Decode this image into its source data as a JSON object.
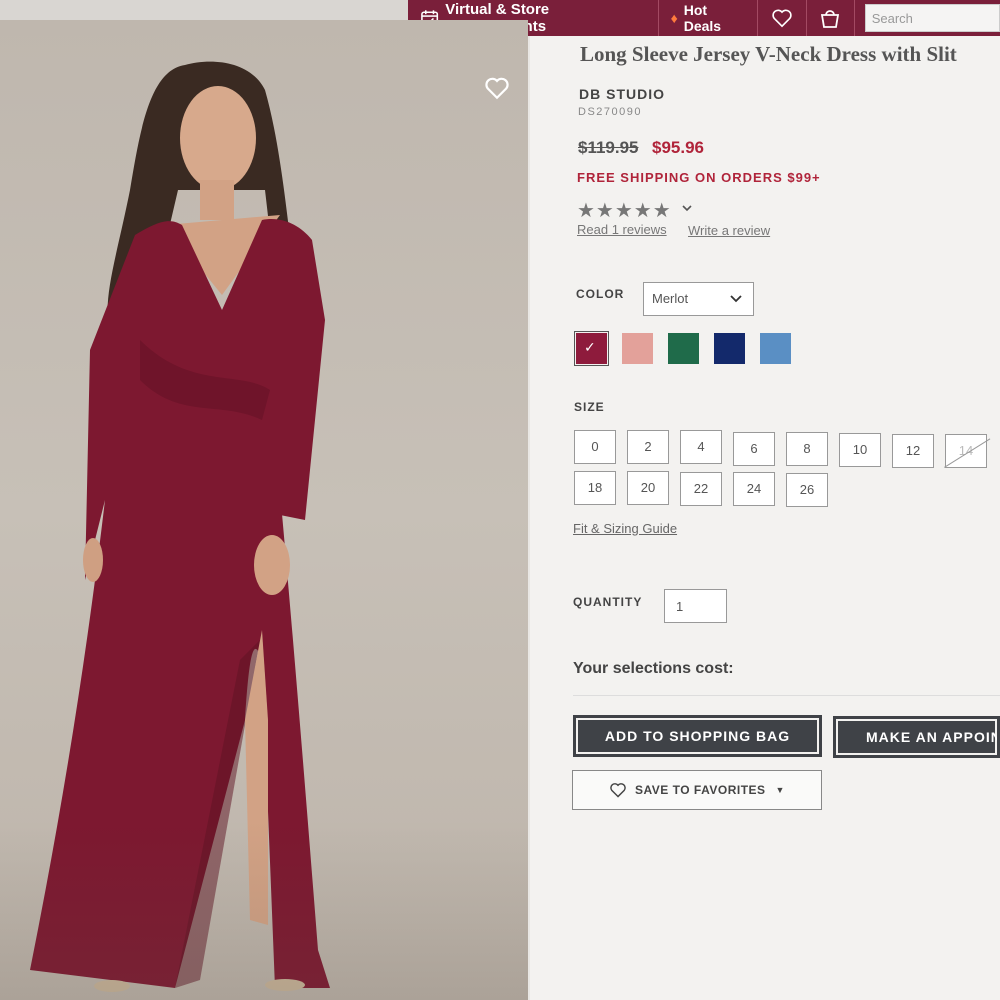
{
  "header": {
    "appointments_label": "Virtual & Store Appointments",
    "hot_deals_label": "Hot Deals",
    "search_placeholder": "Search"
  },
  "product": {
    "title": "Long Sleeve Jersey V-Neck Dress with Slit",
    "brand": "DB STUDIO",
    "sku": "DS270090",
    "price_original": "$119.95",
    "price_sale": "$95.96",
    "shipping_promo": "FREE SHIPPING ON ORDERS $99+",
    "rating": {
      "stars": "★★★★★",
      "value": 5,
      "max": 5
    },
    "read_reviews": "Read 1 reviews",
    "write_review": "Write a review"
  },
  "color": {
    "label": "COLOR",
    "selected": "Merlot",
    "swatches": [
      {
        "name": "merlot",
        "hex": "#8e1b3c",
        "selected": true
      },
      {
        "name": "blush",
        "hex": "#e3a19a",
        "selected": false
      },
      {
        "name": "green",
        "hex": "#1f6b4a",
        "selected": false
      },
      {
        "name": "navy",
        "hex": "#13296b",
        "selected": false
      },
      {
        "name": "blue",
        "hex": "#5a8fc4",
        "selected": false
      }
    ]
  },
  "size": {
    "label": "SIZE",
    "row1": [
      "0",
      "2",
      "4",
      "6",
      "8",
      "10",
      "12",
      "14"
    ],
    "row2": [
      "18",
      "20",
      "22",
      "24",
      "26"
    ],
    "unavailable": [
      "14"
    ],
    "guide_link": "Fit & Sizing Guide"
  },
  "quantity": {
    "label": "QUANTITY",
    "value": "1"
  },
  "selections_cost_label": "Your selections cost:",
  "actions": {
    "add_to_bag": "ADD TO SHOPPING BAG",
    "make_appointment": "MAKE AN APPOINTMENT",
    "save_favorites": "SAVE TO FAVORITES"
  },
  "colors": {
    "brand": "#7a1f3a",
    "sale": "#b0243a",
    "button": "#3f4247"
  }
}
